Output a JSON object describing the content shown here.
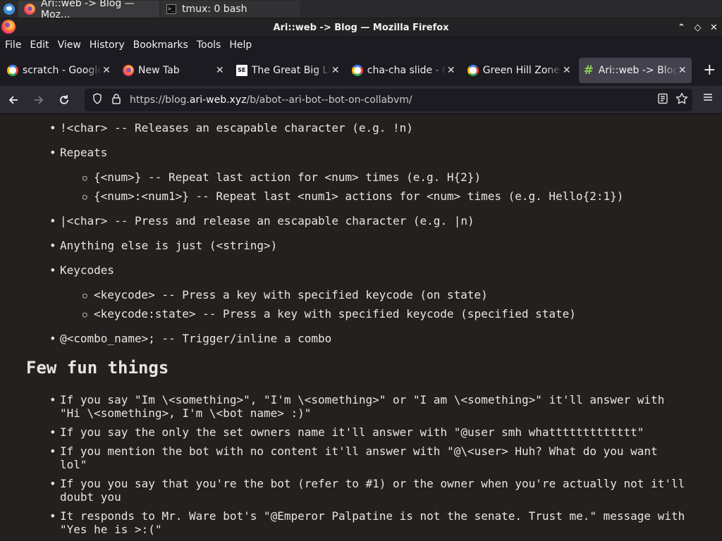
{
  "taskbar": {
    "items": [
      {
        "label": "Ari::web -> Blog — Moz..."
      },
      {
        "label": "tmux: 0 bash"
      }
    ]
  },
  "window": {
    "title": "Ari::web -> Blog — Mozilla Firefox",
    "controls": {
      "minimize": "⌃",
      "restore": "◇",
      "close": "✕"
    }
  },
  "menubar": {
    "items": [
      "File",
      "Edit",
      "View",
      "History",
      "Bookmarks",
      "Tools",
      "Help"
    ]
  },
  "tabs": [
    {
      "label": "scratch - Google",
      "icon": "google-icon"
    },
    {
      "label": "New Tab",
      "icon": "firefox-icon"
    },
    {
      "label": "The Great Big Li",
      "icon": "se-icon"
    },
    {
      "label": "cha-cha slide - G",
      "icon": "google-icon"
    },
    {
      "label": "Green Hill Zone -",
      "icon": "google-icon"
    },
    {
      "label": "Ari::web -> Blog",
      "icon": "hash-icon",
      "active": true
    }
  ],
  "navbar": {
    "url_prefix": "https://blog.",
    "url_host": "ari-web.xyz",
    "url_path": "/b/abot--ari-bot--bot-on-collabvm/"
  },
  "content": {
    "items": [
      "!<char> -- Releases an escapable character (e.g. !n)",
      "Repeats",
      "{<num>} -- Repeat last action for <num> times (e.g. H{2})",
      "{<num>:<num1>} -- Repeat last <num1> actions for <num> times (e.g. Hello{2:1})",
      "|<char> -- Press and release an escapable character (e.g. |n)",
      "Anything else is just (<string>)",
      "Keycodes",
      "<keycode> -- Press a key with specified keycode (on state)",
      "<keycode:state> -- Press a key with specified keycode (specified state)",
      "@<combo_name>; -- Trigger/inline a combo"
    ],
    "heading": "Few fun things",
    "fun": [
      "If you say \"Im \\<something>\", \"I'm \\<something>\" or \"I am \\<something>\" it'll answer with\n\"Hi \\<something>, I'm \\<bot name> :)\"",
      "If you say the only the set owners name it'll answer with \"@user smh whattttttttttttt\"",
      "If you mention the bot with no content it'll answer with \"@\\<user> Huh? What do you want\nlol\"",
      "If you you say that you're the bot (refer to #1) or the owner when you're actually not it'll\ndoubt you",
      "It responds to Mr. Ware bot's \"@Emperor Palpatine is not the senate. Trust me.\" message with\n\"Yes he is >:(\""
    ]
  }
}
